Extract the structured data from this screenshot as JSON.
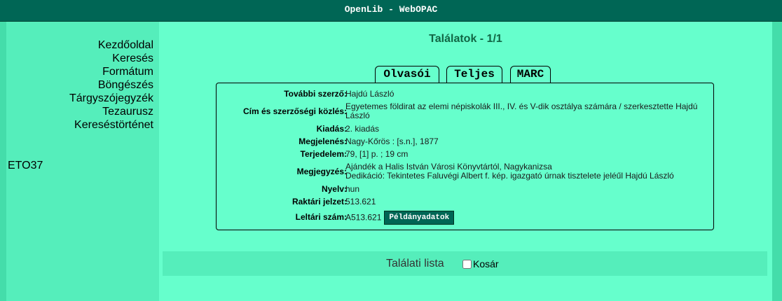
{
  "header": {
    "title": "OpenLib - WebOPAC"
  },
  "sidebar": {
    "items": [
      {
        "label": "Kezdőoldal"
      },
      {
        "label": "Keresés"
      },
      {
        "label": "Formátum"
      },
      {
        "label": "Böngészés"
      },
      {
        "label": "Tárgyszójegyzék"
      },
      {
        "label": "Tezaurusz"
      },
      {
        "label": "Keresés­történet"
      }
    ],
    "eto": "ETO37"
  },
  "main": {
    "results_title": "Találatok - 1/1",
    "tabs": [
      {
        "label": "Olvasói",
        "active": false
      },
      {
        "label": "Teljes",
        "active": true
      },
      {
        "label": "MARC",
        "active": false
      }
    ],
    "record": {
      "tovabbi_szerzo": {
        "label": "További szerző:",
        "value": "Hajdú László"
      },
      "cim": {
        "label": "Cím és szerzőségi közlés:",
        "value": "Egyetemes földirat az elemi népiskolák III., IV. és V-dik osztálya számára / szerkesztette Hajdú László"
      },
      "kiadas": {
        "label": "Kiadás:",
        "value": "2. kiadás"
      },
      "megjelenes": {
        "label": "Megjelenés:",
        "value": "Nagy-Kőrös : [s.n.], 1877"
      },
      "terjedelem": {
        "label": "Terjedelem:",
        "value": "79, [1] p. ; 19 cm"
      },
      "megjegyzes": {
        "label": "Megjegyzés:",
        "value1": "Ajándék a Halis István Városi Könyvtártól, Nagykanizsa",
        "value2": "Dedikáció: Tekintetes Faluvégi Albert f. kép. igazgató úrnak tisztelete jeléűl Hajdú László"
      },
      "nyelv": {
        "label": "Nyelv:",
        "value": "hun"
      },
      "raktari": {
        "label": "Raktári jelzet:",
        "value": "513.621"
      },
      "leltari": {
        "label": "Leltári szám:",
        "value": "A513.621",
        "button": "Példányadatok"
      }
    },
    "bottom": {
      "list_link": "Találati lista",
      "kosar": "Kosár"
    }
  }
}
